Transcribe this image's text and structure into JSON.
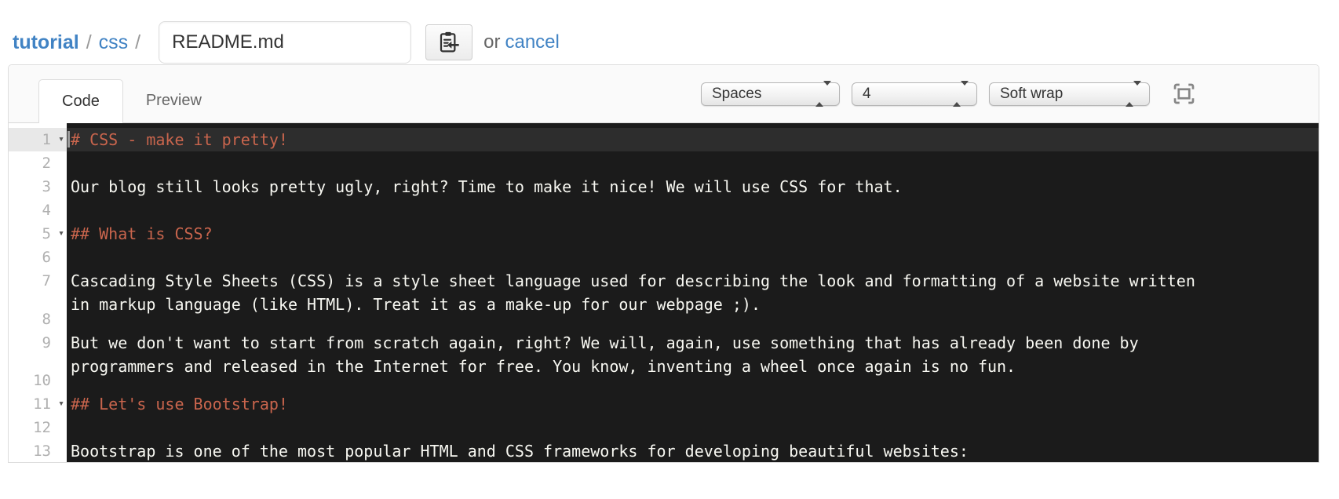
{
  "breadcrumb": {
    "repo": "tutorial",
    "separator": "/",
    "folder": "css",
    "filename": "README.md",
    "or_text": "or",
    "cancel_label": "cancel"
  },
  "toolbar": {
    "tabs": [
      {
        "label": "Code",
        "active": true
      },
      {
        "label": "Preview",
        "active": false
      }
    ],
    "selects": [
      {
        "name": "indent-mode",
        "value": "Spaces"
      },
      {
        "name": "indent-size",
        "value": "4"
      },
      {
        "name": "wrap-mode",
        "value": "Soft wrap"
      }
    ],
    "icons": {
      "clipboard": "clipboard-arrow-icon",
      "fullscreen": "screen-full-icon",
      "select_stepper": "up-down-arrows-icon",
      "fold": "chevron-down-icon"
    }
  },
  "colors": {
    "link_blue": "#4183c4",
    "code_background": "#1b1b1b",
    "active_line_background": "#2d2d2d",
    "heading_orange": "#c9654d",
    "code_text": "#f8f8f2",
    "gutter_number": "#b0b0b0"
  },
  "editor": {
    "language": "markdown",
    "lines": [
      {
        "number": 1,
        "foldable": true,
        "type": "heading",
        "active": true,
        "text": "# CSS - make it pretty!"
      },
      {
        "number": 2,
        "foldable": false,
        "type": "text",
        "active": false,
        "text": ""
      },
      {
        "number": 3,
        "foldable": false,
        "type": "text",
        "active": false,
        "text": "Our blog still looks pretty ugly, right? Time to make it nice! We will use CSS for that."
      },
      {
        "number": 4,
        "foldable": false,
        "type": "text",
        "active": false,
        "text": ""
      },
      {
        "number": 5,
        "foldable": true,
        "type": "heading",
        "active": false,
        "text": "## What is CSS?"
      },
      {
        "number": 6,
        "foldable": false,
        "type": "text",
        "active": false,
        "text": ""
      },
      {
        "number": 7,
        "foldable": false,
        "type": "text",
        "active": false,
        "text": "Cascading Style Sheets (CSS) is a style sheet language used for describing the look and formatting of a website written in markup language (like HTML). Treat it as a make-up for our webpage ;)."
      },
      {
        "number": 8,
        "foldable": false,
        "type": "text",
        "active": false,
        "text": ""
      },
      {
        "number": 9,
        "foldable": false,
        "type": "text",
        "active": false,
        "text": "But we don't want to start from scratch again, right? We will, again, use something that has already been done by programmers and released in the Internet for free. You know, inventing a wheel once again is no fun."
      },
      {
        "number": 10,
        "foldable": false,
        "type": "text",
        "active": false,
        "text": ""
      },
      {
        "number": 11,
        "foldable": true,
        "type": "heading",
        "active": false,
        "text": "## Let's use Bootstrap!"
      },
      {
        "number": 12,
        "foldable": false,
        "type": "text",
        "active": false,
        "text": ""
      },
      {
        "number": 13,
        "foldable": false,
        "type": "text",
        "active": false,
        "text": "Bootstrap is one of the most popular HTML and CSS frameworks for developing beautiful websites:"
      }
    ]
  }
}
